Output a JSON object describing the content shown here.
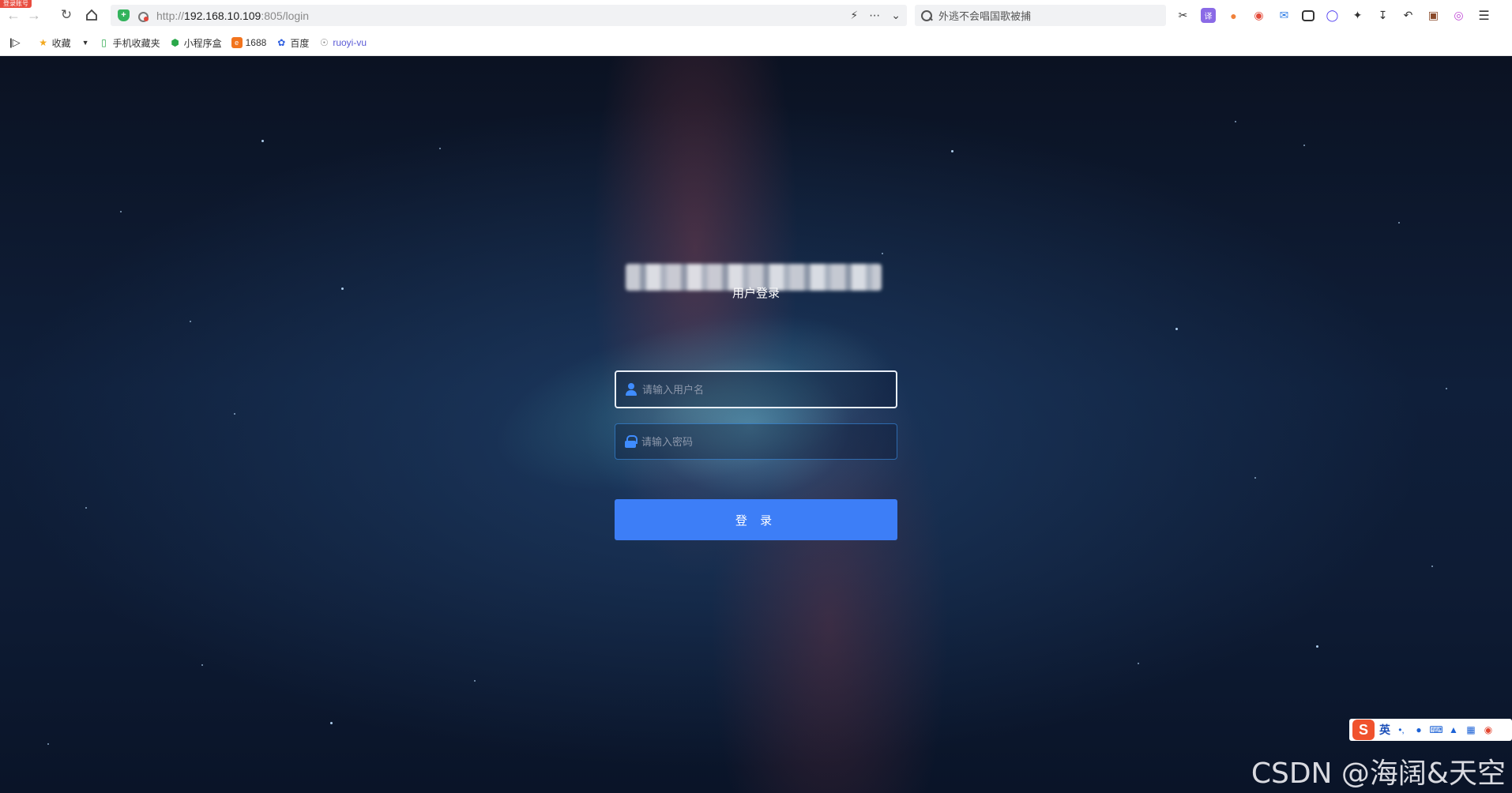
{
  "browser": {
    "corner_badge": "登录账号",
    "url_scheme": "http://",
    "url_host": "192.168.10.109",
    "url_path": ":805/login",
    "search_placeholder": "外逃不会唱国歌被捕",
    "icons": {
      "back": "arrow-left-icon",
      "forward": "arrow-right-icon",
      "reload": "reload-icon",
      "home": "home-icon",
      "lightning": "lightning-icon",
      "more": "more-icon",
      "dropdown": "chevron-down-icon"
    }
  },
  "bookmarks": {
    "items": [
      {
        "label": "收藏",
        "icon": "star-icon"
      },
      {
        "label": "手机收藏夹",
        "icon": "phone-icon"
      },
      {
        "label": "小程序盒",
        "icon": "miniapp-icon"
      },
      {
        "label": "1688",
        "icon": "1688-icon"
      },
      {
        "label": "百度",
        "icon": "baidu-paw-icon"
      },
      {
        "label": "ruoyi-vu",
        "icon": "globe-icon"
      }
    ]
  },
  "login": {
    "title": "用户登录",
    "username_placeholder": "请输入用户名",
    "password_placeholder": "请输入密码",
    "submit_label": "登 录"
  },
  "ime": {
    "logo": "S",
    "lang": "英"
  },
  "watermark": "CSDN @海阔&天空",
  "colors": {
    "primary_button": "#3d7ef7",
    "input_icon": "#3f8cff",
    "background_dark": "#0f1f3a"
  }
}
